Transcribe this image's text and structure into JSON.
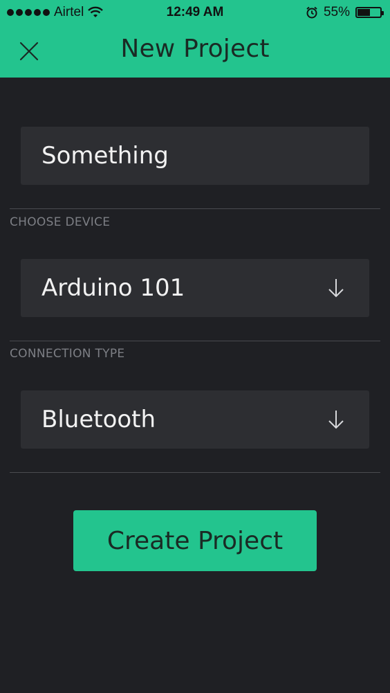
{
  "status_bar": {
    "carrier": "Airtel",
    "time": "12:49 AM",
    "battery_percent": "55%",
    "battery_level": 0.55,
    "icons": [
      "signal-dots-icon",
      "wifi-icon",
      "alarm-icon",
      "battery-icon"
    ]
  },
  "header": {
    "title": "New Project",
    "close_icon": "close-icon"
  },
  "form": {
    "project_name_value": "Something",
    "choose_device_label": "CHOOSE DEVICE",
    "device_value": "Arduino 101",
    "connection_type_label": "CONNECTION TYPE",
    "connection_value": "Bluetooth",
    "dropdown_icon": "arrow-down-icon"
  },
  "actions": {
    "create_label": "Create Project"
  },
  "colors": {
    "accent": "#23c48e",
    "background": "#1f2024",
    "field": "#2d2e32",
    "label": "#7d7f85"
  }
}
